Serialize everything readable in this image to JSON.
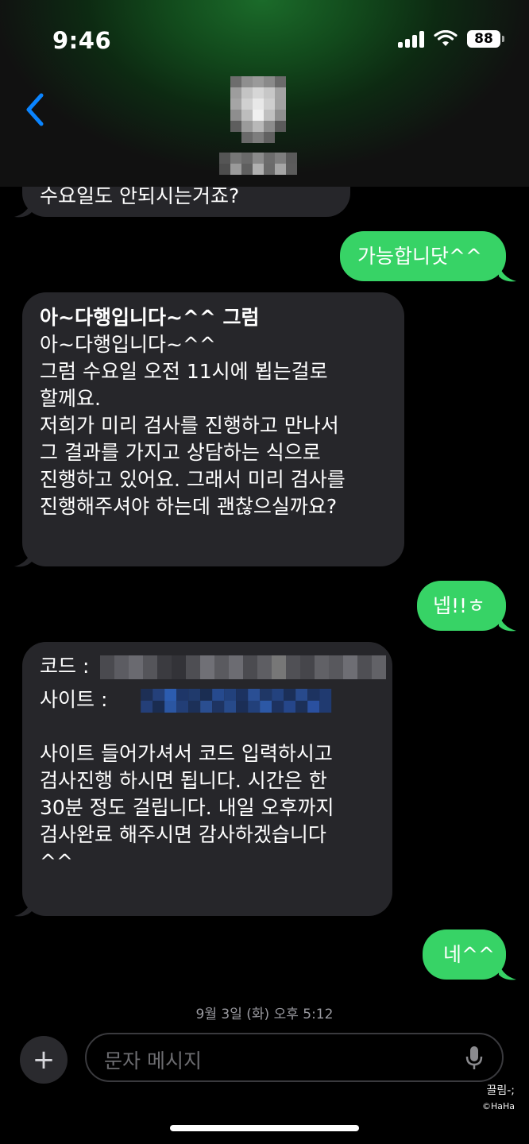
{
  "status": {
    "time": "9:46",
    "battery": "88"
  },
  "thread": {
    "partial_top": "수요일도 안되시는거죠?",
    "messages_out": [
      "가능합니닷^^",
      "넵!!ㅎ",
      "네^^"
    ],
    "msg2": {
      "title": "아~다행입니다~^^ 그럼",
      "lines": [
        "아~다행입니다~^^",
        "그럼 수요일 오전 11시에 뵙는걸로",
        "할께요.",
        "저희가 미리 검사를 진행하고 만나서",
        "그 결과를 가지고 상담하는 식으로",
        "진행하고 있어요. 그래서 미리 검사를",
        "진행해주셔야 하는데 괜찮으실까요?"
      ]
    },
    "msg3": {
      "code_label": "코드 :",
      "site_label": "사이트 :",
      "lines": [
        "사이트 들어가셔서 코드 입력하시고",
        "검사진행 하시면 됩니다. 시간은 한",
        "30분 정도 걸립니다. 내일 오후까지",
        "검사완료 해주시면 감사하겠습니다",
        "^^"
      ]
    },
    "timestamp": "9월 3일 (화) 오후 5:12"
  },
  "composer": {
    "placeholder": "문자 메시지",
    "plus": "+"
  },
  "watermark": {
    "line1": "끌림-;",
    "line2": "©HaHa"
  },
  "colors": {
    "outgoing": "#37d366",
    "incoming": "#26262a",
    "accent": "#0a84ff"
  }
}
